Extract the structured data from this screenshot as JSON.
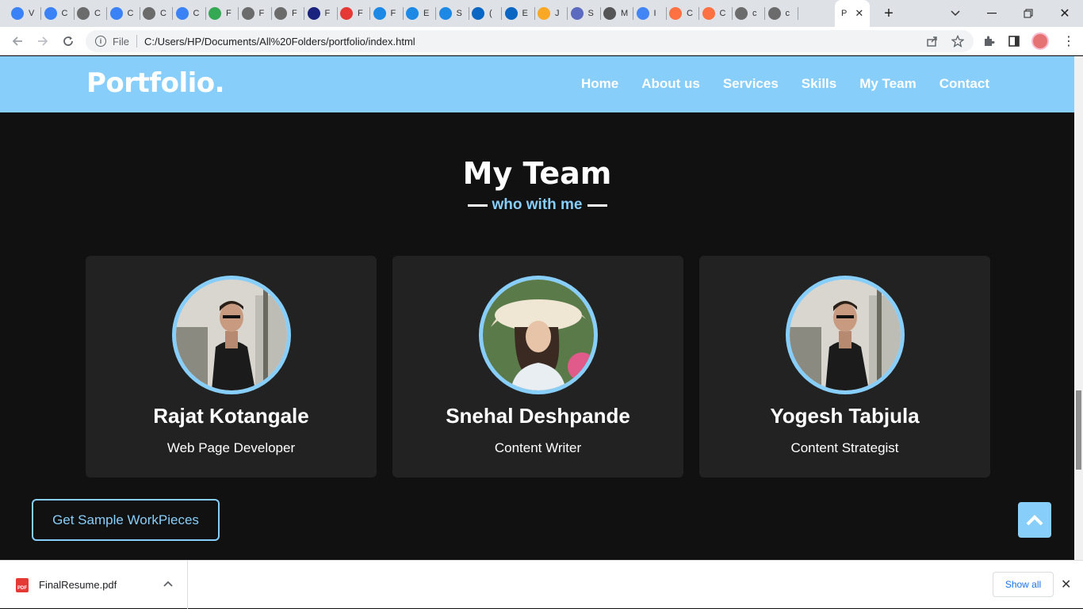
{
  "browser": {
    "active_tab_label": "P",
    "new_tab": "+",
    "tabs": [
      {
        "letter": "V",
        "color": "#3b82f6"
      },
      {
        "letter": "C",
        "color": "#3b82f6"
      },
      {
        "letter": "C",
        "color": "#6b6b6b"
      },
      {
        "letter": "C",
        "color": "#3b82f6"
      },
      {
        "letter": "C",
        "color": "#6b6b6b"
      },
      {
        "letter": "C",
        "color": "#3b82f6"
      },
      {
        "letter": "F",
        "color": "#34a853"
      },
      {
        "letter": "F",
        "color": "#6b6b6b"
      },
      {
        "letter": "F",
        "color": "#6b6b6b"
      },
      {
        "letter": "F",
        "color": "#1a237e"
      },
      {
        "letter": "F",
        "color": "#e53935"
      },
      {
        "letter": "F",
        "color": "#1e88e5"
      },
      {
        "letter": "E",
        "color": "#1e88e5"
      },
      {
        "letter": "S",
        "color": "#1e88e5"
      },
      {
        "letter": "(",
        "color": "#0a66c2"
      },
      {
        "letter": "E",
        "color": "#0a66c2"
      },
      {
        "letter": "J",
        "color": "#f9a825"
      },
      {
        "letter": "S",
        "color": "#5c6bc0"
      },
      {
        "letter": "M",
        "color": "#555555"
      },
      {
        "letter": "I",
        "color": "#4285f4"
      },
      {
        "letter": "C",
        "color": "#ff7043"
      },
      {
        "letter": "C",
        "color": "#ff7043"
      },
      {
        "letter": "c",
        "color": "#6b6b6b"
      },
      {
        "letter": "c",
        "color": "#6b6b6b"
      }
    ],
    "url_scheme": "File",
    "url": "C:/Users/HP/Documents/All%20Folders/portfolio/index.html"
  },
  "site": {
    "logo": "Portfolio.",
    "nav": [
      "Home",
      "About us",
      "Services",
      "Skills",
      "My Team",
      "Contact"
    ],
    "section_title": "My Team",
    "section_subtitle": "who with me",
    "members": [
      {
        "name": "Rajat Kotangale",
        "role": "Web Page Developer"
      },
      {
        "name": "Snehal Deshpande",
        "role": "Content Writer"
      },
      {
        "name": "Yogesh Tabjula",
        "role": "Content Strategist"
      }
    ],
    "cta": "Get Sample WorkPieces",
    "accent_color": "#87cefa",
    "card_color": "#222222",
    "background_color": "#111111"
  },
  "downloads": {
    "file_name": "FinalResume.pdf",
    "file_badge": "PDF",
    "show_all": "Show all"
  }
}
